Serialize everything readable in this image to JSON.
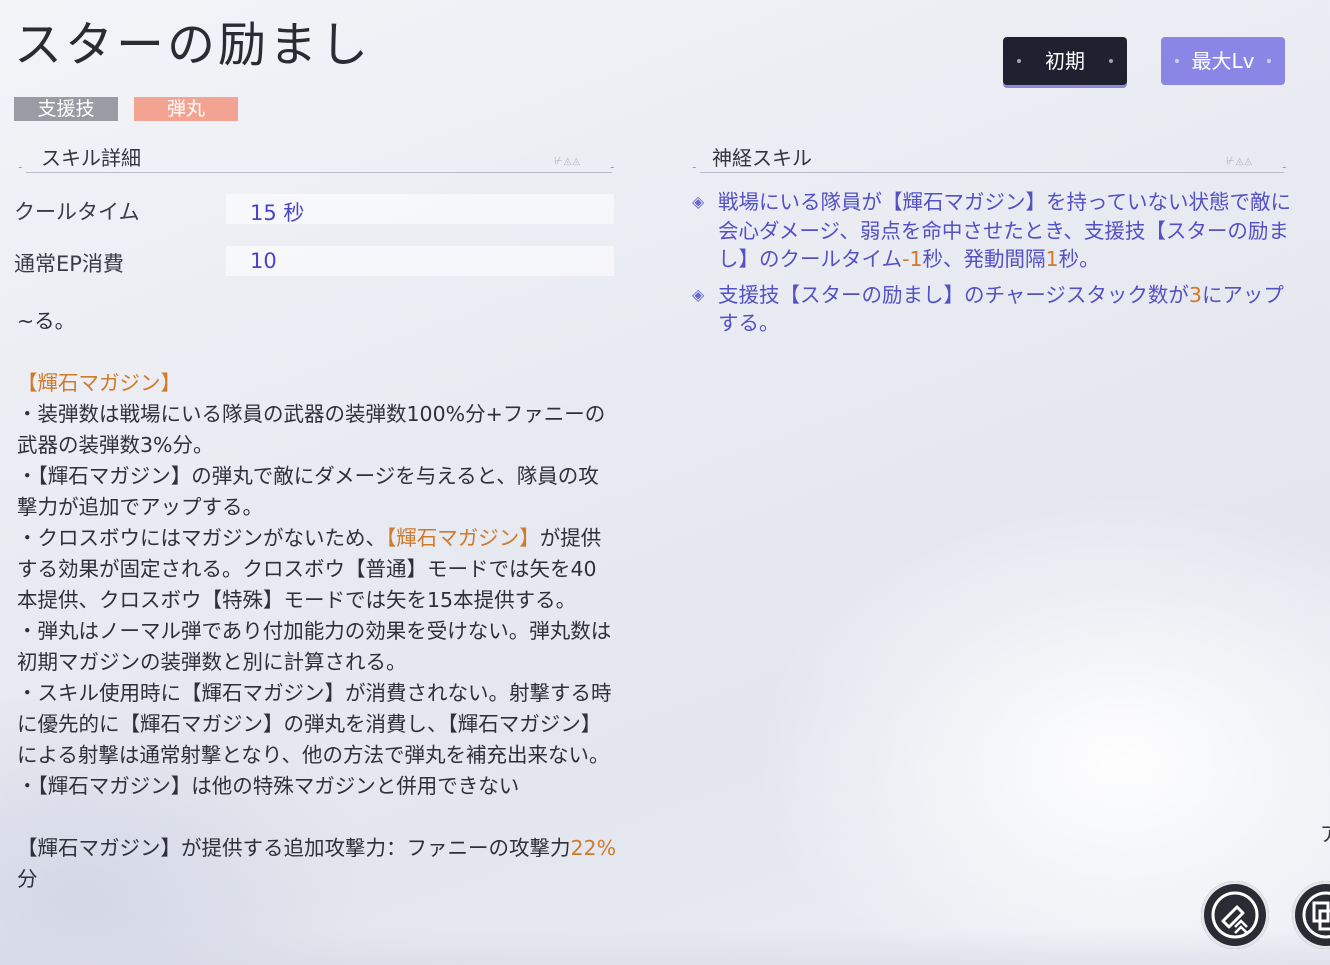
{
  "header": {
    "title": "スターの励まし",
    "tags": [
      "支援技",
      "弾丸"
    ],
    "buttons": {
      "initial": "初期",
      "max_level": "最大Lv"
    }
  },
  "skill_detail": {
    "heading": "スキル詳細",
    "rows": [
      {
        "label": "クールタイム",
        "value": "15 秒"
      },
      {
        "label": "通常EP消費",
        "value": "10"
      }
    ],
    "description": {
      "fragment": "~る。",
      "section_title": "【輝石マガジン】",
      "line1": "・装弾数は戦場にいる隊員の武器の装弾数100%分+ファニーの武器の装弾数3%分。",
      "line2": "・【輝石マガジン】の弾丸で敵にダメージを与えると、隊員の攻撃力が追加でアップする。",
      "line3_pre": "・クロスボウにはマガジンがないため、",
      "line3_hl": "【輝石マガジン】",
      "line3_post": "が提供する効果が固定される。クロスボウ【普通】モードでは矢を40本提供、クロスボウ【特殊】モードでは矢を15本提供する。",
      "line4": "・弾丸はノーマル弾であり付加能力の効果を受けない。弾丸数は初期マガジンの装弾数と別に計算される。",
      "line5": "・スキル使用時に【輝石マガジン】が消費されない。射撃する時に優先的に【輝石マガジン】の弾丸を消費し、【輝石マガジン】による射撃は通常射撃となり、他の方法で弾丸を補充出来ない。",
      "line6": "・【輝石マガジン】は他の特殊マガジンと併用できない",
      "final_pre": "【輝石マガジン】が提供する追加攻撃力：ファニーの攻撃力",
      "final_hl": "22%",
      "final_post": "分"
    }
  },
  "neural_skill": {
    "heading": "神経スキル",
    "bullet1_pre": "戦場にいる隊員が【輝石マガジン】を持っていない状態で敵に会心ダメージ、弱点を命中させたとき、支援技【スターの励まし】のクールタイム",
    "bullet1_n1": "-1",
    "bullet1_mid": "秒、発動間隔",
    "bullet1_n2": "1",
    "bullet1_post": "秒。",
    "bullet2_pre": "支援技【スターの励まし】のチャージスタック数が",
    "bullet2_n": "3",
    "bullet2_post": "にアップする。"
  },
  "edge_text": "ア",
  "icons": [
    "diamond-bullet-icon",
    "upgrade-icon",
    "menu-icon"
  ],
  "colors": {
    "accent": "#8a86e6",
    "highlight": "#d07a2c",
    "text_blue": "#5450c6"
  }
}
